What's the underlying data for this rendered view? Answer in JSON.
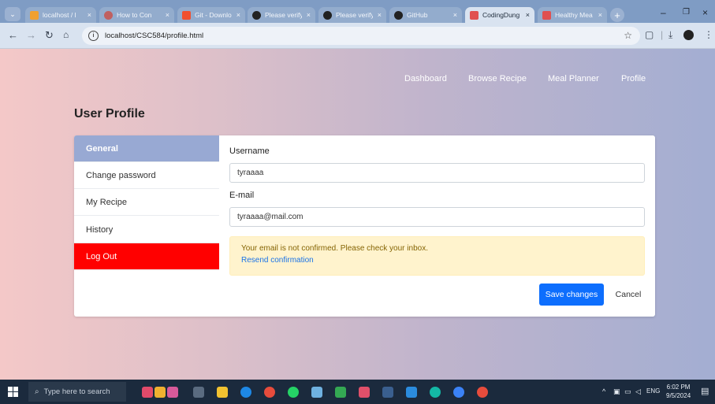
{
  "browser": {
    "tabs": [
      {
        "label": "localhost / l",
        "fav": "#f0a030",
        "active": false
      },
      {
        "label": "How to Con",
        "fav": "#c06060",
        "active": false
      },
      {
        "label": "Git - Downlo",
        "fav": "#f05030",
        "active": false
      },
      {
        "label": "Please verify",
        "fav": "#222222",
        "active": false
      },
      {
        "label": "Please verify",
        "fav": "#222222",
        "active": false
      },
      {
        "label": "GitHub",
        "fav": "#222222",
        "active": false
      },
      {
        "label": "CodingDung",
        "fav": "#e05050",
        "active": true
      },
      {
        "label": "Healthy Mea",
        "fav": "#e05050",
        "active": false
      }
    ],
    "url": "localhost/CSC584/profile.html"
  },
  "nav": {
    "links": [
      "Dashboard",
      "Browse Recipe",
      "Meal Planner",
      "Profile"
    ]
  },
  "profile": {
    "title": "User Profile",
    "menu": [
      "General",
      "Change password",
      "My Recipe",
      "History",
      "Log Out"
    ],
    "username_label": "Username",
    "username_value": "tyraaaa",
    "email_label": "E-mail",
    "email_value": "tyraaaa@mail.com",
    "alert_text": "Your email is not confirmed. Please check your inbox.",
    "alert_link": "Resend confirmation",
    "save_label": "Save changes",
    "cancel_label": "Cancel"
  },
  "taskbar": {
    "search_placeholder": "Type here to search",
    "lang": "ENG",
    "time": "6:02 PM",
    "date": "9/5/2024"
  },
  "colors": {
    "accent": "#98a9d3",
    "danger": "#ff0000",
    "primary": "#0d6efd",
    "alert_bg": "#fff3cd"
  }
}
